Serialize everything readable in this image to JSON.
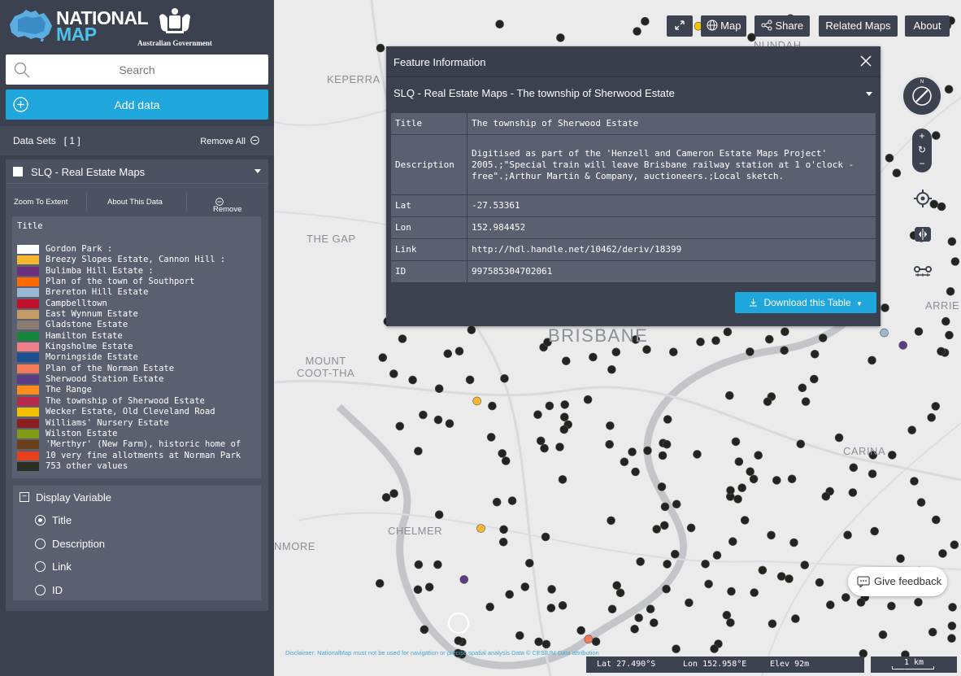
{
  "brand": {
    "line1": "NATIONAL",
    "line2": "MAP",
    "gov": "Australian Government"
  },
  "search": {
    "placeholder": "Search"
  },
  "add_data": {
    "label": "Add data"
  },
  "datasets": {
    "title": "Data Sets   [ 1 ]",
    "remove_all": "Remove All"
  },
  "dataset": {
    "name": "SLQ - Real Estate Maps",
    "zoom_to_extent": "Zoom To Extent",
    "about": "About This Data",
    "remove": "Remove",
    "legend_title": "Title",
    "legend": [
      {
        "label": "Gordon Park :",
        "color": "#ffffff"
      },
      {
        "label": "Breezy Slopes Estate, Cannon Hill :",
        "color": "#f5b82e"
      },
      {
        "label": "Bulimba Hill Estate :",
        "color": "#6e2e7e"
      },
      {
        "label": "Plan of the town of Southport",
        "color": "#ff6a00"
      },
      {
        "label": "Brereton Hill Estate",
        "color": "#9bb7d6"
      },
      {
        "label": "Campbelltown",
        "color": "#c0102a"
      },
      {
        "label": "East Wynnum Estate",
        "color": "#c19a66"
      },
      {
        "label": "Gladstone Estate",
        "color": "#8a7b72"
      },
      {
        "label": "Hamilton Estate",
        "color": "#17843c"
      },
      {
        "label": "Kingsholme Estate",
        "color": "#f07f8c"
      },
      {
        "label": "Morningside Estate",
        "color": "#1b4f8f"
      },
      {
        "label": "Plan of the Norman Estate",
        "color": "#f47a5c"
      },
      {
        "label": "Sherwood Station Estate",
        "color": "#5a3d82"
      },
      {
        "label": "The Range",
        "color": "#ff8c1a"
      },
      {
        "label": "The township of Sherwood Estate",
        "color": "#b8284d"
      },
      {
        "label": "Wecker Estate, Old Cleveland Road",
        "color": "#f2c200"
      },
      {
        "label": "Williams' Nursery Estate",
        "color": "#8b1e1e"
      },
      {
        "label": "Wilston Estate",
        "color": "#7f9a14"
      },
      {
        "label": "'Merthyr' (New Farm), historic home of",
        "color": "#6b3f1c"
      },
      {
        "label": "10 very fine allotments at Norman Park",
        "color": "#e8401c"
      },
      {
        "label": "753 other values",
        "color": "#2b2e22"
      }
    ],
    "display_variable": {
      "title": "Display Variable",
      "options": [
        "Title",
        "Description",
        "Link",
        "ID"
      ],
      "selected": "Title"
    }
  },
  "toolbar": {
    "map": "Map",
    "share": "Share",
    "related": "Related Maps",
    "about": "About"
  },
  "map_labels": {
    "keperra": "KEPERRA",
    "the_gap": "THE GAP",
    "brisbane": "BRISBANE",
    "mount_coot_tha": "MOUNT\nCOOT-THA",
    "carina": "CARINA",
    "chelmer": "CHELMER",
    "nmore": "NMORE",
    "arrie": "ARRIE",
    "nundah": "NUNDAH"
  },
  "feature": {
    "header": "Feature Information",
    "subtitle": "SLQ - Real Estate Maps - The township of Sherwood Estate",
    "rows": [
      {
        "key": "Title",
        "value": "The township of Sherwood Estate"
      },
      {
        "key": "Description",
        "value": "Digitised as part of the 'Henzell and Cameron Estate Maps Project' 2005.;\"Special train will leave Brisbane railway station at 1 o'clock - free\".;Arthur Martin & Company, auctioneers.;Local sketch."
      },
      {
        "key": "Lat",
        "value": "-27.53361"
      },
      {
        "key": "Lon",
        "value": "152.984452"
      },
      {
        "key": "Link",
        "value": "http://hdl.handle.net/10462/deriv/18399"
      },
      {
        "key": "ID",
        "value": "997585304702061"
      }
    ],
    "download": "Download this Table"
  },
  "feedback": "Give feedback",
  "disclaimer": "Disclaimer: NationalMap must not be used for navigation or precise spatial analysis   Data © CESIUM   Data attribution",
  "status": {
    "lat": "Lat  27.490°S",
    "lon": "Lon  152.958°E",
    "elev": "Elev  92m",
    "scale": "1 km"
  }
}
